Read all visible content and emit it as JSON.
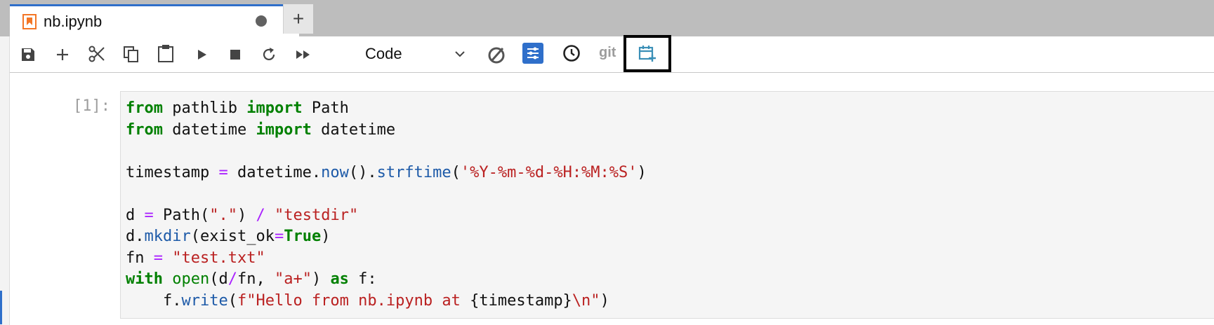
{
  "tab": {
    "title": "nb.ipynb",
    "new_tab_label": "+"
  },
  "toolbar": {
    "cell_type": "Code",
    "git_label": "git",
    "accent_color": "#2f6fca"
  },
  "cell": {
    "prompt": "[1]:",
    "lines": [
      [
        {
          "t": "from",
          "c": "kw"
        },
        {
          "t": " pathlib "
        },
        {
          "t": "import",
          "c": "kw"
        },
        {
          "t": " Path"
        }
      ],
      [
        {
          "t": "from",
          "c": "kw"
        },
        {
          "t": " datetime "
        },
        {
          "t": "import",
          "c": "kw"
        },
        {
          "t": " datetime"
        }
      ],
      [],
      [
        {
          "t": "timestamp "
        },
        {
          "t": "=",
          "c": "op"
        },
        {
          "t": " datetime."
        },
        {
          "t": "now",
          "c": "fn"
        },
        {
          "t": "()."
        },
        {
          "t": "strftime",
          "c": "fn"
        },
        {
          "t": "("
        },
        {
          "t": "'%Y-%m-%d-%H:%M:%S'",
          "c": "str"
        },
        {
          "t": ")"
        }
      ],
      [],
      [
        {
          "t": "d "
        },
        {
          "t": "=",
          "c": "op"
        },
        {
          "t": " Path("
        },
        {
          "t": "\".\"",
          "c": "str"
        },
        {
          "t": ") "
        },
        {
          "t": "/",
          "c": "op"
        },
        {
          "t": " "
        },
        {
          "t": "\"testdir\"",
          "c": "str"
        }
      ],
      [
        {
          "t": "d."
        },
        {
          "t": "mkdir",
          "c": "fn"
        },
        {
          "t": "(exist_ok"
        },
        {
          "t": "=",
          "c": "op"
        },
        {
          "t": "True",
          "c": "kw"
        },
        {
          "t": ")"
        }
      ],
      [
        {
          "t": "fn "
        },
        {
          "t": "=",
          "c": "op"
        },
        {
          "t": " "
        },
        {
          "t": "\"test.txt\"",
          "c": "str"
        }
      ],
      [
        {
          "t": "with",
          "c": "kw"
        },
        {
          "t": " "
        },
        {
          "t": "open",
          "c": "bi"
        },
        {
          "t": "(d"
        },
        {
          "t": "/",
          "c": "op"
        },
        {
          "t": "fn, "
        },
        {
          "t": "\"a+\"",
          "c": "str"
        },
        {
          "t": ") "
        },
        {
          "t": "as",
          "c": "kw"
        },
        {
          "t": " f:"
        }
      ],
      [
        {
          "t": "    f."
        },
        {
          "t": "write",
          "c": "fn"
        },
        {
          "t": "("
        },
        {
          "t": "f\"Hello from nb.ipynb at ",
          "c": "str"
        },
        {
          "t": "{timestamp}"
        },
        {
          "t": "\\n\"",
          "c": "str"
        },
        {
          "t": ")"
        }
      ]
    ]
  }
}
